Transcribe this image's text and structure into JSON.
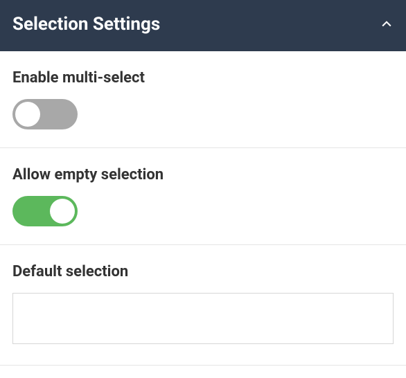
{
  "header": {
    "title": "Selection Settings"
  },
  "settings": {
    "multiSelect": {
      "label": "Enable multi-select",
      "enabled": false
    },
    "allowEmpty": {
      "label": "Allow empty selection",
      "enabled": true
    },
    "defaultSelection": {
      "label": "Default selection",
      "value": ""
    }
  }
}
